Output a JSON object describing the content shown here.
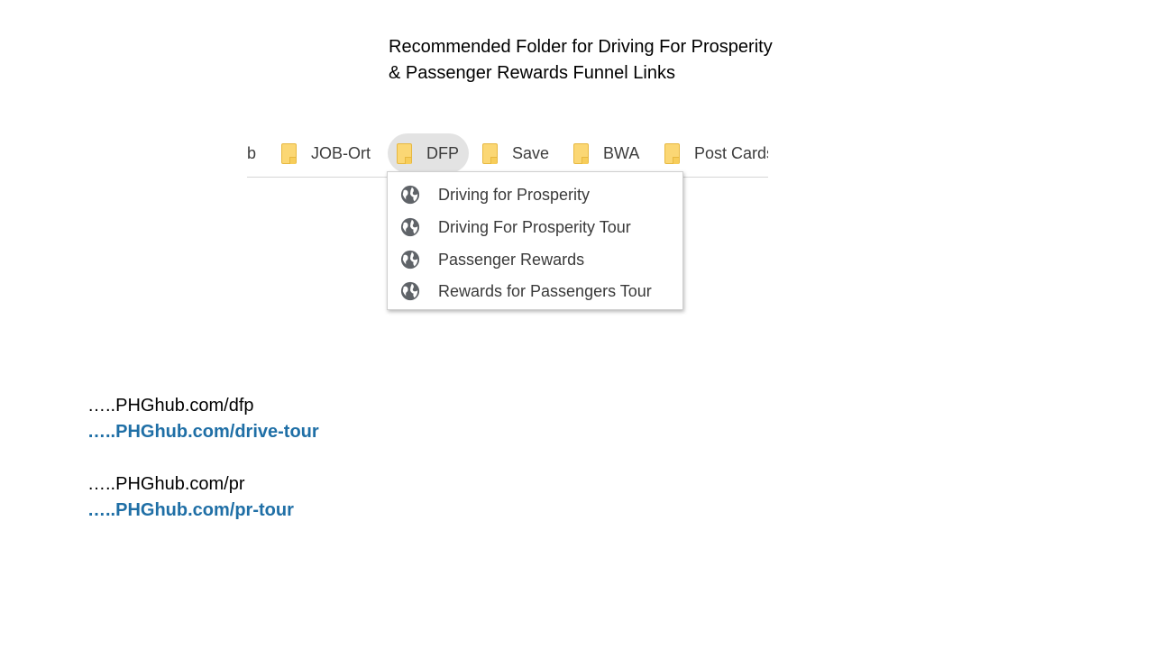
{
  "title": {
    "line1": "Recommended Folder for Driving For Prosperity",
    "line2": "& Passenger Rewards Funnel Links"
  },
  "bookmarks_bar": {
    "partial_item": "b",
    "folders": [
      {
        "label": "JOB-Ort",
        "icon": "folder-icon"
      },
      {
        "label": "DFP",
        "icon": "folder-icon",
        "active": true
      },
      {
        "label": "Save",
        "icon": "folder-icon"
      },
      {
        "label": "BWA",
        "icon": "folder-icon"
      },
      {
        "label": "Post Cards",
        "icon": "folder-icon"
      }
    ]
  },
  "dropdown": {
    "items": [
      {
        "label": "Driving for Prosperity",
        "icon": "globe-icon"
      },
      {
        "label": "Driving For Prosperity Tour",
        "icon": "globe-icon"
      },
      {
        "label": "Passenger Rewards",
        "icon": "globe-icon"
      },
      {
        "label": "Rewards for Passengers Tour",
        "icon": "globe-icon"
      }
    ]
  },
  "links": [
    {
      "text": "…..PHGhub.com/dfp",
      "style": "plain"
    },
    {
      "text": "…..PHGhub.com/drive-tour",
      "style": "bold"
    },
    {
      "text": "…..PHGhub.com/pr",
      "style": "plain"
    },
    {
      "text": "…..PHGhub.com/pr-tour",
      "style": "bold"
    }
  ],
  "colors": {
    "folder_fill": "#fbd774",
    "active_pill": "#e3e3e3",
    "link_blue": "#1f6fa6"
  }
}
